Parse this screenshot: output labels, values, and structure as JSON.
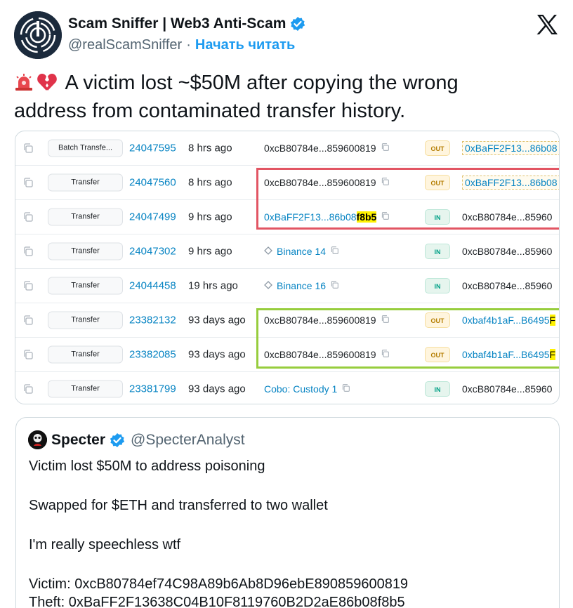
{
  "author": {
    "display_name": "Scam Sniffer | Web3 Anti-Scam",
    "handle": "@realScamSniffer",
    "separator": "·",
    "follow_label": "Начать читать"
  },
  "tweet": {
    "text_line1": "A victim lost ~$50M after copying the wrong",
    "text_line2": "address from contaminated transfer history."
  },
  "transactions": [
    {
      "method": "Batch Transfe...",
      "block": "24047595",
      "age": "8 hrs ago",
      "from": "0xcB80784e...859600819",
      "from_link": false,
      "dir": "OUT",
      "to_prefix": "0xBaFF2F13...86b08",
      "to_hl": "",
      "to_dashed": true
    },
    {
      "method": "Transfer",
      "block": "24047560",
      "age": "8 hrs ago",
      "from": "0xcB80784e...859600819",
      "from_link": false,
      "dir": "OUT",
      "to_prefix": "0xBaFF2F13...86b08",
      "to_hl": "",
      "to_dashed": true
    },
    {
      "method": "Transfer",
      "block": "24047499",
      "age": "9 hrs ago",
      "from": "0xBaFF2F13...86b08",
      "from_hl": "f8b5",
      "from_link": true,
      "dir": "IN",
      "to_prefix": "0xcB80784e...85960",
      "to_hl": "",
      "to_dashed": false
    },
    {
      "method": "Transfer",
      "block": "24047302",
      "age": "9 hrs ago",
      "from": "Binance 14",
      "from_link": true,
      "from_icon": "contract-icon",
      "dir": "IN",
      "to_prefix": "0xcB80784e...85960",
      "to_hl": "",
      "to_dashed": false
    },
    {
      "method": "Transfer",
      "block": "24044458",
      "age": "19 hrs ago",
      "from": "Binance 16",
      "from_link": true,
      "from_icon": "contract-icon",
      "dir": "IN",
      "to_prefix": "0xcB80784e...85960",
      "to_hl": "",
      "to_dashed": false
    },
    {
      "method": "Transfer",
      "block": "23382132",
      "age": "93 days ago",
      "from": "0xcB80784e...859600819",
      "from_link": false,
      "dir": "OUT",
      "to_prefix": "0xbaf4b1aF...B6495",
      "to_hl": "F",
      "to_dashed": false
    },
    {
      "method": "Transfer",
      "block": "23382085",
      "age": "93 days ago",
      "from": "0xcB80784e...859600819",
      "from_link": false,
      "dir": "OUT",
      "to_prefix": "0xbaf4b1aF...B6495",
      "to_hl": "F",
      "to_dashed": false
    },
    {
      "method": "Transfer",
      "block": "23381799",
      "age": "93 days ago",
      "from": "Cobo: Custody 1",
      "from_link": true,
      "dir": "IN",
      "to_prefix": "0xcB80784e...85960",
      "to_hl": "",
      "to_dashed": false
    }
  ],
  "quote": {
    "display_name": "Specter",
    "handle": "@SpecterAnalyst",
    "lines": [
      "Victim lost $50M to address poisoning",
      "Swapped for $ETH and transferred to two wallet",
      "I'm really speechless wtf",
      "Victim: 0xcB80784ef74C98A89b6Ab8D96ebE890859600819",
      "Theft: 0xBaFF2F13638C04B10F8119760B2D2aE86b08f8b5"
    ]
  },
  "colors": {
    "link": "#1d9bf0",
    "etherscan_link": "#0784c3",
    "red_highlight_box": "#e25563",
    "green_highlight_box": "#97cd3d",
    "yellow_highlight": "#fff200"
  }
}
